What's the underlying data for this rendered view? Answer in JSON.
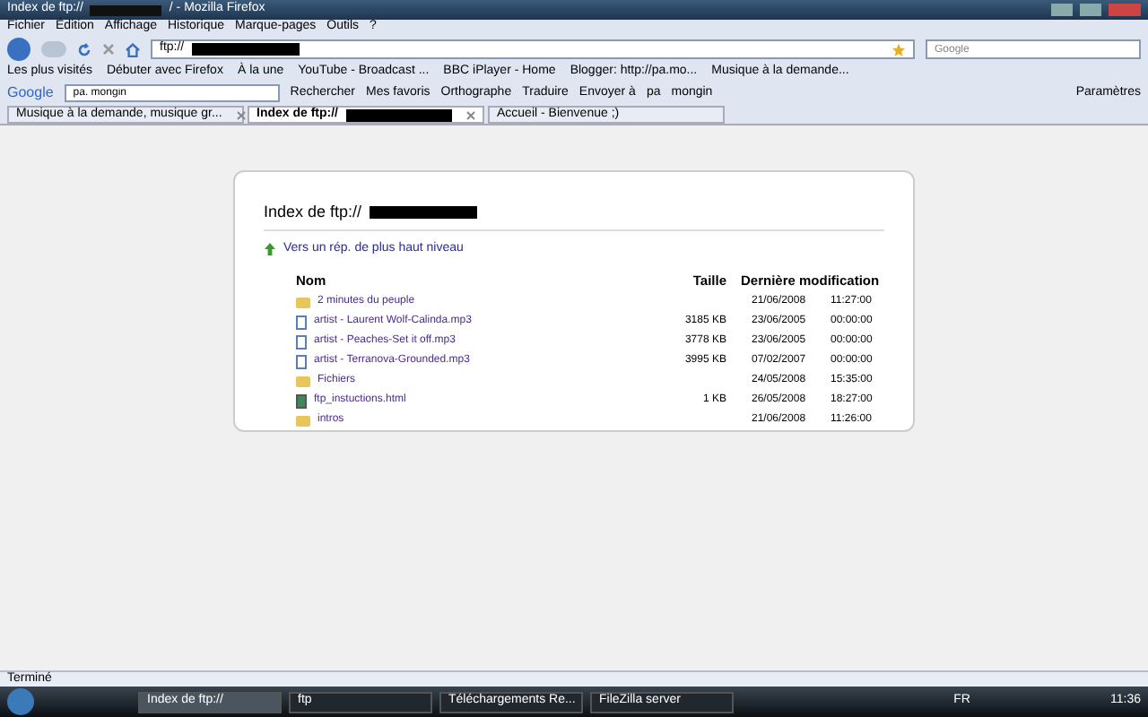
{
  "window": {
    "title_start": "Index de ftp://",
    "title_end": "/ - Mozilla Firefox"
  },
  "menu": [
    "Fichier",
    "Édition",
    "Affichage",
    "Historique",
    "Marque-pages",
    "Outils",
    "?"
  ],
  "address": {
    "value": "ftp://"
  },
  "search": {
    "placeholder": "Google"
  },
  "bookmarks": [
    "Les plus visités",
    "Débuter avec Firefox",
    "À la une",
    "YouTube - Broadcast ...",
    "BBC iPlayer - Home",
    "Blogger: http://pa.mo...",
    "Musique à la demande..."
  ],
  "google_bar": {
    "logo": "Google",
    "query": "pa. mongin",
    "items": [
      "Rechercher",
      "Mes favoris",
      "Orthographe",
      "Traduire",
      "Envoyer à",
      "pa",
      "mongin",
      "Paramètres"
    ]
  },
  "tabs": [
    {
      "label": "Musique à la demande, musique gr...",
      "selected": false,
      "closable": true
    },
    {
      "label": "Index de ftp://",
      "selected": true,
      "closable": true
    },
    {
      "label": "Accueil - Bienvenue ;)",
      "selected": false,
      "closable": false
    }
  ],
  "page": {
    "heading": "Index de ftp://",
    "up_link": "Vers un rép. de plus haut niveau",
    "columns": [
      "Nom",
      "Taille",
      "Dernière modification"
    ],
    "rows": [
      {
        "kind": "folder",
        "name": "2 minutes du peuple",
        "date": "21/06/2008",
        "time": "11:27:00"
      },
      {
        "kind": "audio",
        "name": "artist - Laurent Wolf-Calinda.mp3",
        "size": "3185 KB",
        "date": "23/06/2005",
        "time": "00:00:00"
      },
      {
        "kind": "audio",
        "name": "artist - Peaches-Set it off.mp3",
        "size": "3778 KB",
        "date": "23/06/2005",
        "time": "00:00:00"
      },
      {
        "kind": "audio",
        "name": "artist - Terranova-Grounded.mp3",
        "size": "3995 KB",
        "date": "07/02/2007",
        "time": "00:00:00"
      },
      {
        "kind": "folder",
        "name": "Fichiers",
        "date": "24/05/2008",
        "time": "15:35:00"
      },
      {
        "kind": "html",
        "name": "ftp_instuctions.html",
        "size": "1 KB",
        "date": "26/05/2008",
        "time": "18:27:00"
      },
      {
        "kind": "folder",
        "name": "intros",
        "date": "21/06/2008",
        "time": "11:26:00"
      }
    ]
  },
  "status_bar": "Terminé",
  "taskbar": [
    {
      "label": "Index de ftp://",
      "selected": true
    },
    {
      "label": "ftp",
      "selected": false
    },
    {
      "label": "Téléchargements Re...",
      "selected": false
    },
    {
      "label": "FileZilla server",
      "selected": false
    }
  ],
  "tray": {
    "language": "FR",
    "clock": "11:36"
  }
}
